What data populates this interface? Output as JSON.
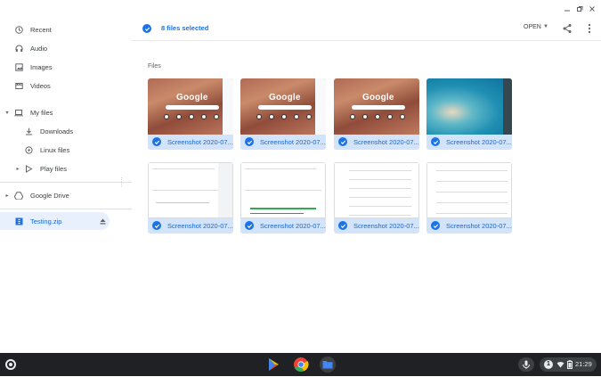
{
  "window": {
    "controls": [
      "minimize",
      "maximize",
      "close"
    ]
  },
  "sidebar": {
    "items": [
      {
        "label": "Recent",
        "icon": "clock-icon"
      },
      {
        "label": "Audio",
        "icon": "headphones-icon"
      },
      {
        "label": "Images",
        "icon": "image-icon"
      },
      {
        "label": "Videos",
        "icon": "film-icon"
      },
      {
        "label": "My files",
        "icon": "laptop-icon"
      },
      {
        "label": "Downloads",
        "icon": "download-icon"
      },
      {
        "label": "Linux files",
        "icon": "linux-icon"
      },
      {
        "label": "Play files",
        "icon": "play-icon"
      },
      {
        "label": "Google Drive",
        "icon": "drive-icon"
      },
      {
        "label": "Testing.zip",
        "icon": "zip-icon"
      }
    ]
  },
  "header": {
    "selection_label": "8 files selected",
    "open_label": "OPEN"
  },
  "main": {
    "section_title": "Files",
    "files": [
      {
        "name": "Screenshot 2020-07...",
        "thumb": "google"
      },
      {
        "name": "Screenshot 2020-07...",
        "thumb": "google"
      },
      {
        "name": "Screenshot 2020-07...",
        "thumb": "google"
      },
      {
        "name": "Screenshot 2020-07...",
        "thumb": "ocean"
      },
      {
        "name": "Screenshot 2020-07...",
        "thumb": "doc"
      },
      {
        "name": "Screenshot 2020-07...",
        "thumb": "doc"
      },
      {
        "name": "Screenshot 2020-07...",
        "thumb": "doc"
      },
      {
        "name": "Screenshot 2020-07...",
        "thumb": "doc"
      }
    ]
  },
  "shelf": {
    "apps": [
      "play-store-icon",
      "chrome-icon",
      "files-icon"
    ],
    "time": "21:29",
    "notification_count": "1"
  },
  "colors": {
    "accent": "#1a73e8",
    "selected_bg": "#d2e3fc",
    "shelf_bg": "#202124"
  }
}
